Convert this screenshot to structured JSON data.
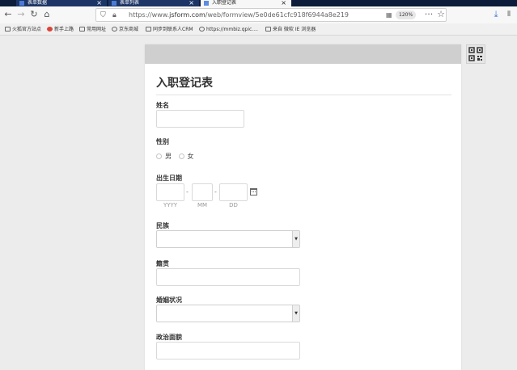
{
  "browser": {
    "tabs": [
      {
        "label": "表单数据",
        "active": false
      },
      {
        "label": "表单列表",
        "active": false
      },
      {
        "label": "入职登记表",
        "active": true
      }
    ],
    "url_prefix": "https://www.",
    "url_host": "jsform.com",
    "url_path": "/web/formview/5e0de61cfc918f6944a8e219",
    "zoom": "120%",
    "bookmarks": [
      "火狐官方站点",
      "新手上路",
      "常用网址",
      "京东商城",
      "同步到联系人CRM",
      "https://mmbiz.qpic....",
      "来自 微软 IE 浏览器"
    ]
  },
  "form": {
    "title": "入职登记表",
    "fields": {
      "name": {
        "label": "姓名"
      },
      "gender": {
        "label": "性别",
        "options": [
          "男",
          "女"
        ]
      },
      "birth": {
        "label": "出生日期",
        "year_hint": "YYYY",
        "month_hint": "MM",
        "day_hint": "DD",
        "sep": "-"
      },
      "ethnicity": {
        "label": "民族"
      },
      "native_place": {
        "label": "籍贯"
      },
      "marital": {
        "label": "婚姻状况"
      },
      "political": {
        "label": "政治面貌"
      }
    }
  },
  "colors": {
    "tab_bg": "#0c1c3a",
    "tab_active_bg": "#f7f7f7",
    "card_header": "#cfcfcf",
    "page_bg": "#ececec"
  }
}
